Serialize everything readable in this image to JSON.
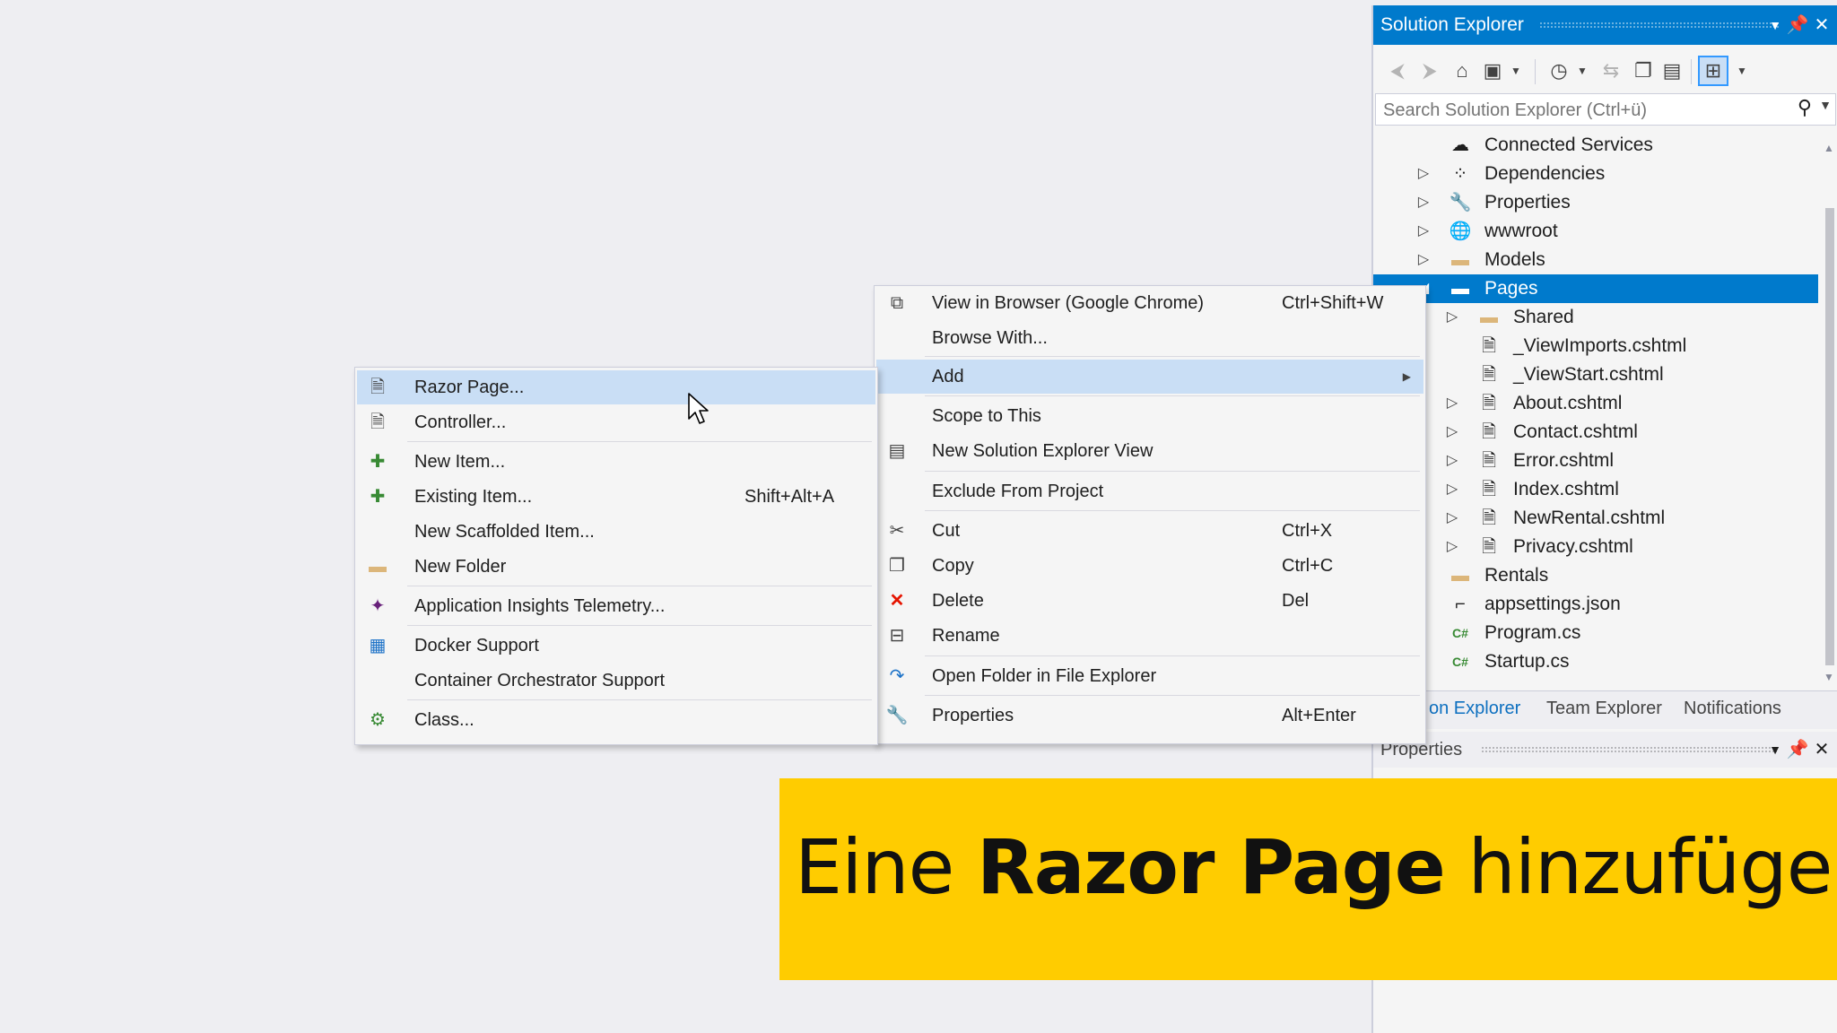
{
  "solution_explorer": {
    "title": "Solution Explorer",
    "search_placeholder": "Search Solution Explorer (Ctrl+ü)",
    "tree": [
      {
        "label": "Connected Services",
        "icon": "cloud-icon",
        "expandable": false
      },
      {
        "label": "Dependencies",
        "icon": "dependencies-icon",
        "expandable": true
      },
      {
        "label": "Properties",
        "icon": "wrench-icon",
        "expandable": true
      },
      {
        "label": "wwwroot",
        "icon": "globe-icon",
        "expandable": true
      },
      {
        "label": "Models",
        "icon": "folder-icon",
        "expandable": true
      },
      {
        "label": "Pages",
        "icon": "folder-open-icon",
        "expandable": true,
        "selected": true
      },
      {
        "label": "Shared",
        "icon": "folder-icon",
        "expandable": true
      },
      {
        "label": "_ViewImports.cshtml",
        "icon": "razor-file-icon",
        "expandable": false
      },
      {
        "label": "_ViewStart.cshtml",
        "icon": "razor-file-icon",
        "expandable": false
      },
      {
        "label": "About.cshtml",
        "icon": "razor-file-icon",
        "expandable": true
      },
      {
        "label": "Contact.cshtml",
        "icon": "razor-file-icon",
        "expandable": true
      },
      {
        "label": "Error.cshtml",
        "icon": "razor-file-icon",
        "expandable": true
      },
      {
        "label": "Index.cshtml",
        "icon": "razor-file-icon",
        "expandable": true
      },
      {
        "label": "NewRental.cshtml",
        "icon": "razor-file-icon",
        "expandable": true
      },
      {
        "label": "Privacy.cshtml",
        "icon": "razor-file-icon",
        "expandable": true
      },
      {
        "label": "Rentals",
        "icon": "folder-icon",
        "expandable": false
      },
      {
        "label": "appsettings.json",
        "icon": "json-file-icon",
        "expandable": false
      },
      {
        "label": "Program.cs",
        "icon": "csharp-file-icon",
        "expandable": false
      },
      {
        "label": "Startup.cs",
        "icon": "csharp-file-icon",
        "expandable": false
      }
    ],
    "bottom_tabs": [
      "on Explorer",
      "Team Explorer",
      "Notifications"
    ],
    "properties_title": "Properties"
  },
  "context_menu": {
    "items": [
      {
        "label": "View in Browser (Google Chrome)",
        "shortcut": "Ctrl+Shift+W",
        "icon": "browser-view-icon"
      },
      {
        "label": "Browse With...",
        "shortcut": "",
        "icon": ""
      },
      {
        "label": "Add",
        "shortcut": "",
        "icon": "",
        "submenu": true,
        "highlighted": true
      },
      {
        "label": "Scope to This",
        "shortcut": "",
        "icon": ""
      },
      {
        "label": "New Solution Explorer View",
        "shortcut": "",
        "icon": "new-view-icon"
      },
      {
        "label": "Exclude From Project",
        "shortcut": "",
        "icon": ""
      },
      {
        "label": "Cut",
        "shortcut": "Ctrl+X",
        "icon": "scissors-icon"
      },
      {
        "label": "Copy",
        "shortcut": "Ctrl+C",
        "icon": "copy-icon"
      },
      {
        "label": "Delete",
        "shortcut": "Del",
        "icon": "delete-icon"
      },
      {
        "label": "Rename",
        "shortcut": "",
        "icon": "rename-icon"
      },
      {
        "label": "Open Folder in File Explorer",
        "shortcut": "",
        "icon": "open-folder-icon"
      },
      {
        "label": "Properties",
        "shortcut": "Alt+Enter",
        "icon": "wrench-icon"
      }
    ]
  },
  "add_submenu": {
    "items": [
      {
        "label": "Razor Page...",
        "shortcut": "",
        "icon": "razor-page-icon",
        "highlighted": true
      },
      {
        "label": "Controller...",
        "shortcut": "",
        "icon": "controller-icon"
      },
      {
        "label": "New Item...",
        "shortcut": "",
        "icon": "new-item-icon"
      },
      {
        "label": "Existing Item...",
        "shortcut": "Shift+Alt+A",
        "icon": "existing-item-icon"
      },
      {
        "label": "New Scaffolded Item...",
        "shortcut": "",
        "icon": ""
      },
      {
        "label": "New Folder",
        "shortcut": "",
        "icon": "new-folder-icon"
      },
      {
        "label": "Application Insights Telemetry...",
        "shortcut": "",
        "icon": "insights-icon"
      },
      {
        "label": "Docker Support",
        "shortcut": "",
        "icon": "docker-icon"
      },
      {
        "label": "Container Orchestrator Support",
        "shortcut": "",
        "icon": ""
      },
      {
        "label": "Class...",
        "shortcut": "",
        "icon": "class-icon"
      }
    ]
  },
  "caption": {
    "part1": "Eine ",
    "bold": "Razor Page",
    "part2": " hinzufügen"
  },
  "colors": {
    "accent": "#007acc",
    "highlight": "#c9def5",
    "caption_bg": "#ffcc00",
    "delete_red": "#e51400"
  }
}
